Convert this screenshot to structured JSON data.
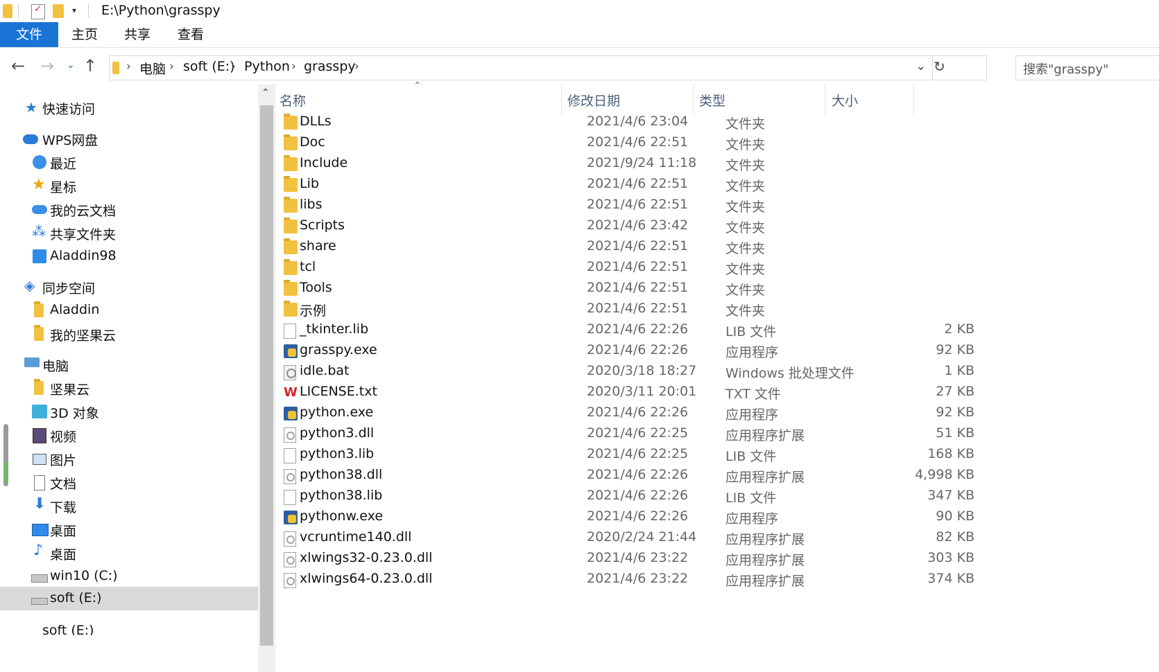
{
  "window": {
    "title": "E:\\Python\\grasspy"
  },
  "ribbon": {
    "tabs": [
      "文件",
      "主页",
      "共享",
      "查看"
    ]
  },
  "address": {
    "crumbs": [
      "电脑",
      "soft (E:)",
      "Python",
      "grasspy"
    ],
    "search_placeholder": "搜索\"grasspy\""
  },
  "sidebar": {
    "items": [
      {
        "label": "快速访问",
        "icon": "star-icon"
      },
      {
        "label": "WPS网盘",
        "icon": "cloud-icon"
      },
      {
        "label": "最近",
        "icon": "clock-icon"
      },
      {
        "label": "星标",
        "icon": "star-icon"
      },
      {
        "label": "我的云文档",
        "icon": "cloud-icon"
      },
      {
        "label": "共享文件夹",
        "icon": "share-icon"
      },
      {
        "label": "Aladdin98",
        "icon": "drive-icon"
      },
      {
        "label": "同步空间",
        "icon": "sync-icon"
      },
      {
        "label": "Aladdin",
        "icon": "folder-icon"
      },
      {
        "label": "我的坚果云",
        "icon": "folder-icon"
      },
      {
        "label": "电脑",
        "icon": "computer-icon"
      },
      {
        "label": "坚果云",
        "icon": "folder-icon"
      },
      {
        "label": "3D 对象",
        "icon": "cube-icon"
      },
      {
        "label": "视频",
        "icon": "film-icon"
      },
      {
        "label": "图片",
        "icon": "picture-icon"
      },
      {
        "label": "文档",
        "icon": "document-icon"
      },
      {
        "label": "下载",
        "icon": "download-icon"
      },
      {
        "label": "桌面",
        "icon": "desktop-icon"
      },
      {
        "label": "桌面",
        "icon": "music-icon"
      },
      {
        "label": "win10 (C:)",
        "icon": "drive-icon"
      },
      {
        "label": "soft (E:)",
        "icon": "drive-icon"
      },
      {
        "label": "soft (E:)",
        "icon": "drive-icon"
      }
    ]
  },
  "columns": {
    "name": "名称",
    "date": "修改日期",
    "type": "类型",
    "size": "大小"
  },
  "files": [
    {
      "name": "DLLs",
      "date": "2021/4/6 23:04",
      "type": "文件夹",
      "size": "",
      "icon": "folder"
    },
    {
      "name": "Doc",
      "date": "2021/4/6 22:51",
      "type": "文件夹",
      "size": "",
      "icon": "folder"
    },
    {
      "name": "Include",
      "date": "2021/9/24 11:18",
      "type": "文件夹",
      "size": "",
      "icon": "folder"
    },
    {
      "name": "Lib",
      "date": "2021/4/6 22:51",
      "type": "文件夹",
      "size": "",
      "icon": "folder"
    },
    {
      "name": "libs",
      "date": "2021/4/6 22:51",
      "type": "文件夹",
      "size": "",
      "icon": "folder"
    },
    {
      "name": "Scripts",
      "date": "2021/4/6 23:42",
      "type": "文件夹",
      "size": "",
      "icon": "folder"
    },
    {
      "name": "share",
      "date": "2021/4/6 22:51",
      "type": "文件夹",
      "size": "",
      "icon": "folder"
    },
    {
      "name": "tcl",
      "date": "2021/4/6 22:51",
      "type": "文件夹",
      "size": "",
      "icon": "folder"
    },
    {
      "name": "Tools",
      "date": "2021/4/6 22:51",
      "type": "文件夹",
      "size": "",
      "icon": "folder"
    },
    {
      "name": "示例",
      "date": "2021/4/6 22:51",
      "type": "文件夹",
      "size": "",
      "icon": "folder"
    },
    {
      "name": "_tkinter.lib",
      "date": "2021/4/6 22:26",
      "type": "LIB 文件",
      "size": "2 KB",
      "icon": "doc"
    },
    {
      "name": "grasspy.exe",
      "date": "2021/4/6 22:26",
      "type": "应用程序",
      "size": "92 KB",
      "icon": "exe"
    },
    {
      "name": "idle.bat",
      "date": "2020/3/18 18:27",
      "type": "Windows 批处理文件",
      "size": "1 KB",
      "icon": "bat"
    },
    {
      "name": "LICENSE.txt",
      "date": "2020/3/11 20:01",
      "type": "TXT 文件",
      "size": "27 KB",
      "icon": "wps"
    },
    {
      "name": "python.exe",
      "date": "2021/4/6 22:26",
      "type": "应用程序",
      "size": "92 KB",
      "icon": "exe"
    },
    {
      "name": "python3.dll",
      "date": "2021/4/6 22:25",
      "type": "应用程序扩展",
      "size": "51 KB",
      "icon": "gear"
    },
    {
      "name": "python3.lib",
      "date": "2021/4/6 22:25",
      "type": "LIB 文件",
      "size": "168 KB",
      "icon": "doc"
    },
    {
      "name": "python38.dll",
      "date": "2021/4/6 22:26",
      "type": "应用程序扩展",
      "size": "4,998 KB",
      "icon": "gear"
    },
    {
      "name": "python38.lib",
      "date": "2021/4/6 22:26",
      "type": "LIB 文件",
      "size": "347 KB",
      "icon": "doc"
    },
    {
      "name": "pythonw.exe",
      "date": "2021/4/6 22:26",
      "type": "应用程序",
      "size": "90 KB",
      "icon": "exe"
    },
    {
      "name": "vcruntime140.dll",
      "date": "2020/2/24 21:44",
      "type": "应用程序扩展",
      "size": "82 KB",
      "icon": "gear"
    },
    {
      "name": "xlwings32-0.23.0.dll",
      "date": "2021/4/6 23:22",
      "type": "应用程序扩展",
      "size": "303 KB",
      "icon": "gear"
    },
    {
      "name": "xlwings64-0.23.0.dll",
      "date": "2021/4/6 23:22",
      "type": "应用程序扩展",
      "size": "374 KB",
      "icon": "gear"
    }
  ],
  "colors": {
    "accent": "#1a74d6",
    "folder": "#f3c140",
    "selected_nav": "#d9d9d9"
  }
}
